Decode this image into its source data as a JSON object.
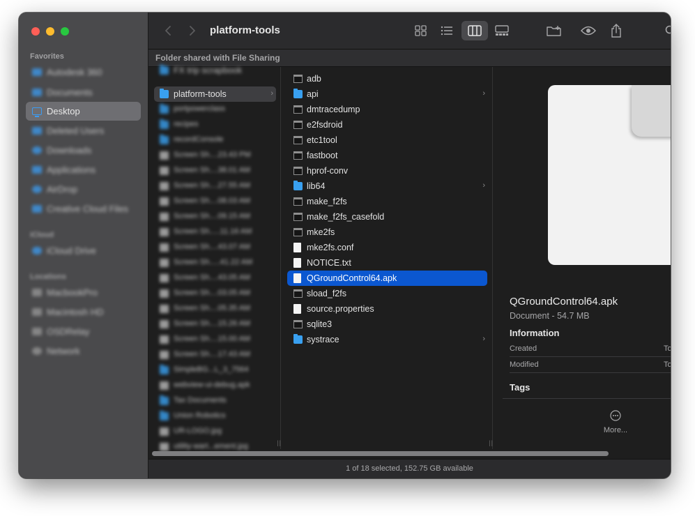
{
  "window": {
    "toolbar": {
      "title": "platform-tools",
      "icons": [
        "chevron-left-icon",
        "chevron-right-icon",
        "icon-view-icon",
        "list-view-icon",
        "column-view-icon",
        "gallery-view-icon",
        "new-folder-icon",
        "quicklook-eye-icon",
        "share-icon",
        "search-icon"
      ]
    },
    "banner": "Folder shared with File Sharing",
    "sidebar": {
      "favorites_heading": "Favorites",
      "items": [
        {
          "label": "Autodesk 360"
        },
        {
          "label": "Documents"
        },
        {
          "label": "Desktop"
        },
        {
          "label": "Deleted Users"
        },
        {
          "label": "Downloads"
        },
        {
          "label": "Applications"
        },
        {
          "label": "AirDrop"
        },
        {
          "label": "Creative Cloud Files"
        }
      ],
      "icloud_heading": "iCloud",
      "icloud_items": [
        {
          "label": "iCloud Drive"
        }
      ],
      "locations_heading": "Locations",
      "location_items": [
        {
          "label": "MacbookPro"
        },
        {
          "label": "Macintosh HD"
        },
        {
          "label": "OSDRelay"
        },
        {
          "label": "Network"
        }
      ],
      "selected_label": "Desktop"
    },
    "column1": {
      "top_partial": "FX trip scrapbook",
      "selected": "platform-tools",
      "items": [
        "portpowerclass",
        "recipes",
        "recordConsole",
        "Screen Sh....23.43 PM",
        "Screen Sh....38.01 AM",
        "Screen Sh....27.55 AM",
        "Screen Sh....08.03 AM",
        "Screen Sh....09.15 AM",
        "Screen Sh.....11.16 AM",
        "Screen Sh....43.07 AM",
        "Screen Sh.....41.22 AM",
        "Screen Sh....43.05 AM",
        "Screen Sh....03.05 AM",
        "Screen Sh....05.35 AM",
        "Screen Sh....15.26 AM",
        "Screen Sh....15.00 AM",
        "Screen Sh....17.43 AM",
        "SimpleBG...L_3_7564",
        "webview-ui-debug.apk",
        "Tax Documents",
        "Union Robotics",
        "UR-LOGO.jpg",
        "utility-wart...ement.jpg"
      ]
    },
    "column2": {
      "items": [
        {
          "name": "adb",
          "type": "exec"
        },
        {
          "name": "api",
          "type": "folder"
        },
        {
          "name": "dmtracedump",
          "type": "exec"
        },
        {
          "name": "e2fsdroid",
          "type": "exec"
        },
        {
          "name": "etc1tool",
          "type": "exec"
        },
        {
          "name": "fastboot",
          "type": "exec"
        },
        {
          "name": "hprof-conv",
          "type": "exec"
        },
        {
          "name": "lib64",
          "type": "folder"
        },
        {
          "name": "make_f2fs",
          "type": "exec"
        },
        {
          "name": "make_f2fs_casefold",
          "type": "exec"
        },
        {
          "name": "mke2fs",
          "type": "exec"
        },
        {
          "name": "mke2fs.conf",
          "type": "doc"
        },
        {
          "name": "NOTICE.txt",
          "type": "doc"
        },
        {
          "name": "QGroundControl64.apk",
          "type": "doc"
        },
        {
          "name": "sload_f2fs",
          "type": "exec"
        },
        {
          "name": "source.properties",
          "type": "doc"
        },
        {
          "name": "sqlite3",
          "type": "exec"
        },
        {
          "name": "systrace",
          "type": "folder"
        }
      ],
      "selected": "QGroundControl64.apk"
    },
    "preview": {
      "name": "QGroundControl64.apk",
      "kind": "Document - 54.7 MB",
      "info_heading": "Information",
      "created_label": "Created",
      "created_value": "To",
      "modified_label": "Modified",
      "modified_value": "To",
      "tags_heading": "Tags",
      "more_label": "More..."
    },
    "status": "1 of 18 selected, 152.75 GB available",
    "colors": {
      "selection": "#0b57d0",
      "folder": "#39a0f0",
      "sidebar_bg": "#4a4a4c",
      "window_bg": "#1e1e1e"
    }
  }
}
